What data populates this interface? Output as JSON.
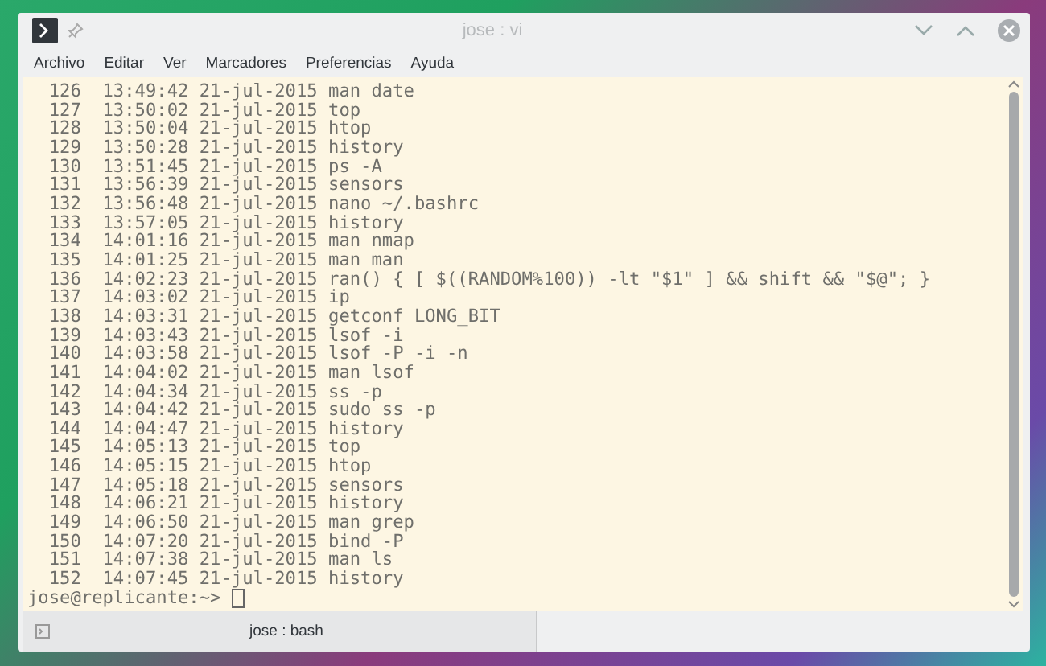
{
  "window": {
    "title": "jose : vi"
  },
  "menu": [
    "Archivo",
    "Editar",
    "Ver",
    "Marcadores",
    "Preferencias",
    "Ayuda"
  ],
  "history": [
    {
      "number": "126",
      "time": "13:49:42",
      "date": "21-jul-2015",
      "command": "man date"
    },
    {
      "number": "127",
      "time": "13:50:02",
      "date": "21-jul-2015",
      "command": "top"
    },
    {
      "number": "128",
      "time": "13:50:04",
      "date": "21-jul-2015",
      "command": "htop"
    },
    {
      "number": "129",
      "time": "13:50:28",
      "date": "21-jul-2015",
      "command": "history"
    },
    {
      "number": "130",
      "time": "13:51:45",
      "date": "21-jul-2015",
      "command": "ps -A"
    },
    {
      "number": "131",
      "time": "13:56:39",
      "date": "21-jul-2015",
      "command": "sensors"
    },
    {
      "number": "132",
      "time": "13:56:48",
      "date": "21-jul-2015",
      "command": "nano ~/.bashrc"
    },
    {
      "number": "133",
      "time": "13:57:05",
      "date": "21-jul-2015",
      "command": "history"
    },
    {
      "number": "134",
      "time": "14:01:16",
      "date": "21-jul-2015",
      "command": "man nmap"
    },
    {
      "number": "135",
      "time": "14:01:25",
      "date": "21-jul-2015",
      "command": "man man"
    },
    {
      "number": "136",
      "time": "14:02:23",
      "date": "21-jul-2015",
      "command": "ran() { [ $((RANDOM%100)) -lt \"$1\" ] && shift && \"$@\"; }"
    },
    {
      "number": "137",
      "time": "14:03:02",
      "date": "21-jul-2015",
      "command": "ip"
    },
    {
      "number": "138",
      "time": "14:03:31",
      "date": "21-jul-2015",
      "command": "getconf LONG_BIT"
    },
    {
      "number": "139",
      "time": "14:03:43",
      "date": "21-jul-2015",
      "command": "lsof -i"
    },
    {
      "number": "140",
      "time": "14:03:58",
      "date": "21-jul-2015",
      "command": "lsof -P -i -n"
    },
    {
      "number": "141",
      "time": "14:04:02",
      "date": "21-jul-2015",
      "command": "man lsof"
    },
    {
      "number": "142",
      "time": "14:04:34",
      "date": "21-jul-2015",
      "command": "ss -p"
    },
    {
      "number": "143",
      "time": "14:04:42",
      "date": "21-jul-2015",
      "command": "sudo ss -p"
    },
    {
      "number": "144",
      "time": "14:04:47",
      "date": "21-jul-2015",
      "command": "history"
    },
    {
      "number": "145",
      "time": "14:05:13",
      "date": "21-jul-2015",
      "command": "top"
    },
    {
      "number": "146",
      "time": "14:05:15",
      "date": "21-jul-2015",
      "command": "htop"
    },
    {
      "number": "147",
      "time": "14:05:18",
      "date": "21-jul-2015",
      "command": "sensors"
    },
    {
      "number": "148",
      "time": "14:06:21",
      "date": "21-jul-2015",
      "command": "history"
    },
    {
      "number": "149",
      "time": "14:06:50",
      "date": "21-jul-2015",
      "command": "man grep"
    },
    {
      "number": "150",
      "time": "14:07:20",
      "date": "21-jul-2015",
      "command": "bind -P"
    },
    {
      "number": "151",
      "time": "14:07:38",
      "date": "21-jul-2015",
      "command": "man ls"
    },
    {
      "number": "152",
      "time": "14:07:45",
      "date": "21-jul-2015",
      "command": "history"
    }
  ],
  "prompt": "jose@replicante:~>",
  "tabs": [
    {
      "label": "jose : bash",
      "selected": true
    }
  ]
}
